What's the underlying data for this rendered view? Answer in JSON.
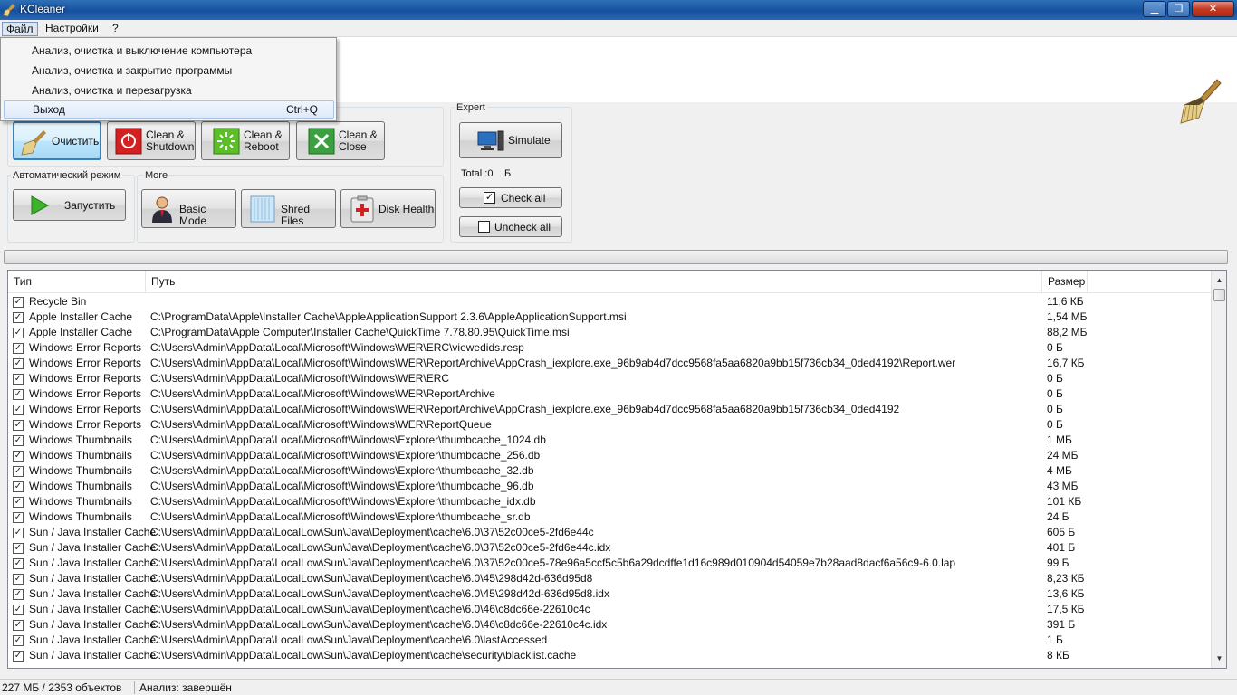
{
  "window": {
    "title": "KCleaner"
  },
  "menubar": {
    "file": "Файл",
    "settings": "Настройки",
    "help": "?"
  },
  "file_menu": {
    "items": [
      {
        "label": "Анализ, очистка и выключение компьютера",
        "shortcut": ""
      },
      {
        "label": "Анализ, очистка и закрытие программы",
        "shortcut": ""
      },
      {
        "label": "Анализ, очистка и перезагрузка",
        "shortcut": ""
      },
      {
        "label": "Выход",
        "shortcut": "Ctrl+Q"
      }
    ]
  },
  "toolbar": {
    "clean_label": "Очистить",
    "clean_shutdown_label": "Clean &\nShutdown",
    "clean_reboot_label": "Clean &\nReboot",
    "clean_close_label": "Clean &\nClose"
  },
  "auto_mode": {
    "group_label": "Автоматический режим",
    "start_label": "Запустить"
  },
  "more": {
    "group_label": "More",
    "basic_mode": "Basic Mode",
    "shred_files": "Shred Files",
    "disk_health": "Disk Health"
  },
  "expert": {
    "group_label": "Expert",
    "simulate": "Simulate",
    "total": "Total :0",
    "total_unit": "Б",
    "check_all": "Check all",
    "uncheck_all": "Uncheck all"
  },
  "list": {
    "columns": {
      "type": "Тип",
      "path": "Путь",
      "size": "Размер"
    },
    "rows": [
      {
        "type": "Recycle Bin",
        "path": "",
        "size": "11,6 КБ"
      },
      {
        "type": "Apple Installer Cache",
        "path": "C:\\ProgramData\\Apple\\Installer Cache\\AppleApplicationSupport 2.3.6\\AppleApplicationSupport.msi",
        "size": "1,54 МБ"
      },
      {
        "type": "Apple Installer Cache",
        "path": "C:\\ProgramData\\Apple Computer\\Installer Cache\\QuickTime 7.78.80.95\\QuickTime.msi",
        "size": "88,2 МБ"
      },
      {
        "type": "Windows Error Reports",
        "path": "C:\\Users\\Admin\\AppData\\Local\\Microsoft\\Windows\\WER\\ERC\\viewedids.resp",
        "size": "0   Б"
      },
      {
        "type": "Windows Error Reports",
        "path": "C:\\Users\\Admin\\AppData\\Local\\Microsoft\\Windows\\WER\\ReportArchive\\AppCrash_iexplore.exe_96b9ab4d7dcc9568fa5aa6820a9bb15f736cb34_0ded4192\\Report.wer",
        "size": "16,7 КБ"
      },
      {
        "type": "Windows Error Reports",
        "path": "C:\\Users\\Admin\\AppData\\Local\\Microsoft\\Windows\\WER\\ERC",
        "size": "0   Б"
      },
      {
        "type": "Windows Error Reports",
        "path": "C:\\Users\\Admin\\AppData\\Local\\Microsoft\\Windows\\WER\\ReportArchive",
        "size": "0   Б"
      },
      {
        "type": "Windows Error Reports",
        "path": "C:\\Users\\Admin\\AppData\\Local\\Microsoft\\Windows\\WER\\ReportArchive\\AppCrash_iexplore.exe_96b9ab4d7dcc9568fa5aa6820a9bb15f736cb34_0ded4192",
        "size": "0   Б"
      },
      {
        "type": "Windows Error Reports",
        "path": "C:\\Users\\Admin\\AppData\\Local\\Microsoft\\Windows\\WER\\ReportQueue",
        "size": "0   Б"
      },
      {
        "type": "Windows Thumbnails",
        "path": "C:\\Users\\Admin\\AppData\\Local\\Microsoft\\Windows\\Explorer\\thumbcache_1024.db",
        "size": "1 МБ"
      },
      {
        "type": "Windows Thumbnails",
        "path": "C:\\Users\\Admin\\AppData\\Local\\Microsoft\\Windows\\Explorer\\thumbcache_256.db",
        "size": "24 МБ"
      },
      {
        "type": "Windows Thumbnails",
        "path": "C:\\Users\\Admin\\AppData\\Local\\Microsoft\\Windows\\Explorer\\thumbcache_32.db",
        "size": "4 МБ"
      },
      {
        "type": "Windows Thumbnails",
        "path": "C:\\Users\\Admin\\AppData\\Local\\Microsoft\\Windows\\Explorer\\thumbcache_96.db",
        "size": "43 МБ"
      },
      {
        "type": "Windows Thumbnails",
        "path": "C:\\Users\\Admin\\AppData\\Local\\Microsoft\\Windows\\Explorer\\thumbcache_idx.db",
        "size": "101 КБ"
      },
      {
        "type": "Windows Thumbnails",
        "path": "C:\\Users\\Admin\\AppData\\Local\\Microsoft\\Windows\\Explorer\\thumbcache_sr.db",
        "size": "24   Б"
      },
      {
        "type": "Sun / Java Installer Cache",
        "path": "C:\\Users\\Admin\\AppData\\LocalLow\\Sun\\Java\\Deployment\\cache\\6.0\\37\\52c00ce5-2fd6e44c",
        "size": "605   Б"
      },
      {
        "type": "Sun / Java Installer Cache",
        "path": "C:\\Users\\Admin\\AppData\\LocalLow\\Sun\\Java\\Deployment\\cache\\6.0\\37\\52c00ce5-2fd6e44c.idx",
        "size": "401   Б"
      },
      {
        "type": "Sun / Java Installer Cache",
        "path": "C:\\Users\\Admin\\AppData\\LocalLow\\Sun\\Java\\Deployment\\cache\\6.0\\37\\52c00ce5-78e96a5ccf5c5b6a29dcdffe1d16c989d010904d54059e7b28aad8dacf6a56c9-6.0.lap",
        "size": "99   Б"
      },
      {
        "type": "Sun / Java Installer Cache",
        "path": "C:\\Users\\Admin\\AppData\\LocalLow\\Sun\\Java\\Deployment\\cache\\6.0\\45\\298d42d-636d95d8",
        "size": "8,23 КБ"
      },
      {
        "type": "Sun / Java Installer Cache",
        "path": "C:\\Users\\Admin\\AppData\\LocalLow\\Sun\\Java\\Deployment\\cache\\6.0\\45\\298d42d-636d95d8.idx",
        "size": "13,6 КБ"
      },
      {
        "type": "Sun / Java Installer Cache",
        "path": "C:\\Users\\Admin\\AppData\\LocalLow\\Sun\\Java\\Deployment\\cache\\6.0\\46\\c8dc66e-22610c4c",
        "size": "17,5 КБ"
      },
      {
        "type": "Sun / Java Installer Cache",
        "path": "C:\\Users\\Admin\\AppData\\LocalLow\\Sun\\Java\\Deployment\\cache\\6.0\\46\\c8dc66e-22610c4c.idx",
        "size": "391   Б"
      },
      {
        "type": "Sun / Java Installer Cache",
        "path": "C:\\Users\\Admin\\AppData\\LocalLow\\Sun\\Java\\Deployment\\cache\\6.0\\lastAccessed",
        "size": "1   Б"
      },
      {
        "type": "Sun / Java Installer Cache",
        "path": "C:\\Users\\Admin\\AppData\\LocalLow\\Sun\\Java\\Deployment\\cache\\security\\blacklist.cache",
        "size": "8 КБ"
      }
    ]
  },
  "status": {
    "summary": "227 МБ / 2353 объектов",
    "state": "Анализ: завершён"
  }
}
